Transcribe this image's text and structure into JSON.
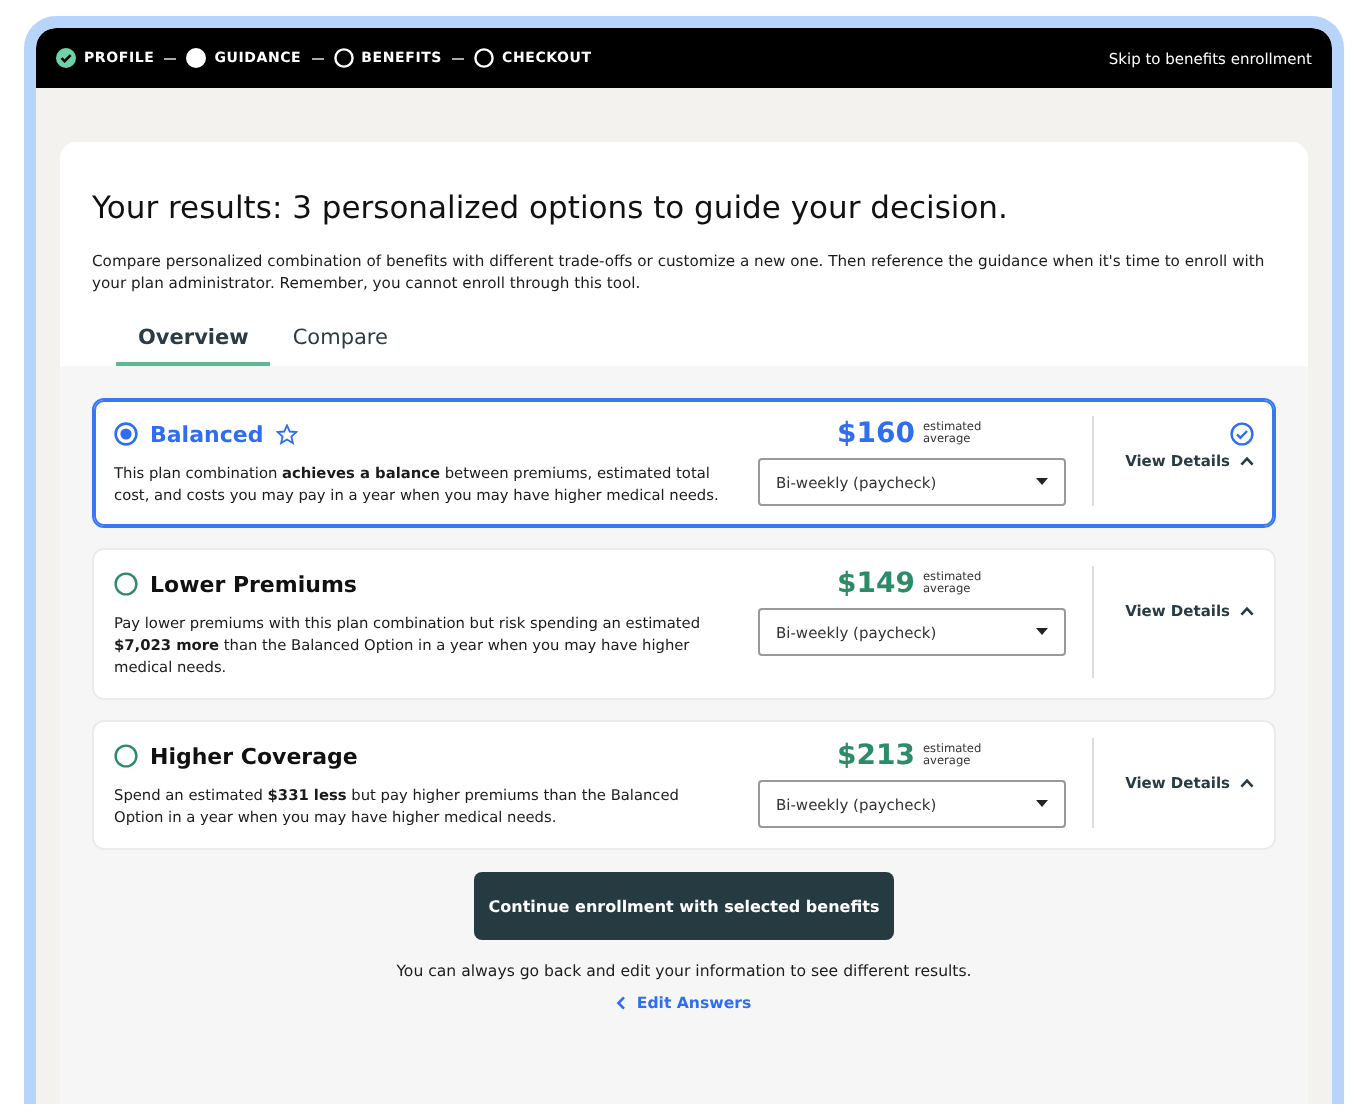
{
  "steps": [
    {
      "label": "PROFILE",
      "completed": true,
      "current": false
    },
    {
      "label": "GUIDANCE",
      "completed": false,
      "current": true
    },
    {
      "label": "BENEFITS",
      "completed": false,
      "current": false
    },
    {
      "label": "CHECKOUT",
      "completed": false,
      "current": false
    }
  ],
  "skip_link": "Skip to benefits enrollment",
  "heading": "Your results: 3 personalized options to guide your decision.",
  "intro": "Compare personalized combination of benefits with different trade-offs or customize a new one. Then reference the guidance when it's time to enroll with your plan administrator. Remember, you cannot enroll through this tool.",
  "tabs": [
    {
      "label": "Overview",
      "selected": true
    },
    {
      "label": "Compare",
      "selected": false
    }
  ],
  "options": [
    {
      "title": "Balanced",
      "selected": true,
      "recommended": true,
      "price": "$160",
      "price_note": "estimated average",
      "description": "This plan combination **achieves a balance** between premiums, estimated total cost, and costs you may pay in a year when you may have higher medical needs.",
      "frequency": "Bi-weekly (paycheck)",
      "details": "View Details"
    },
    {
      "title": "Lower Premiums",
      "selected": false,
      "recommended": false,
      "price": "$149",
      "price_note": "estimated average",
      "description": "Pay lower premiums with this plan combination but risk spending an estimated **$7,023 more** than the Balanced Option in a year when you may have higher medical needs.",
      "frequency": "Bi-weekly (paycheck)",
      "details": "View Details"
    },
    {
      "title": "Higher Coverage",
      "selected": false,
      "recommended": false,
      "price": "$213",
      "price_note": "estimated average",
      "description": "Spend an estimated **$331 less** but pay higher premiums than the Balanced Option in a year when you may have higher medical needs.",
      "frequency": "Bi-weekly (paycheck)",
      "details": "View Details"
    }
  ],
  "continue_button": "Continue enrollment with selected benefits",
  "footer_note": "You can always go back and edit your information to see different results.",
  "edit_link": "Edit Answers"
}
